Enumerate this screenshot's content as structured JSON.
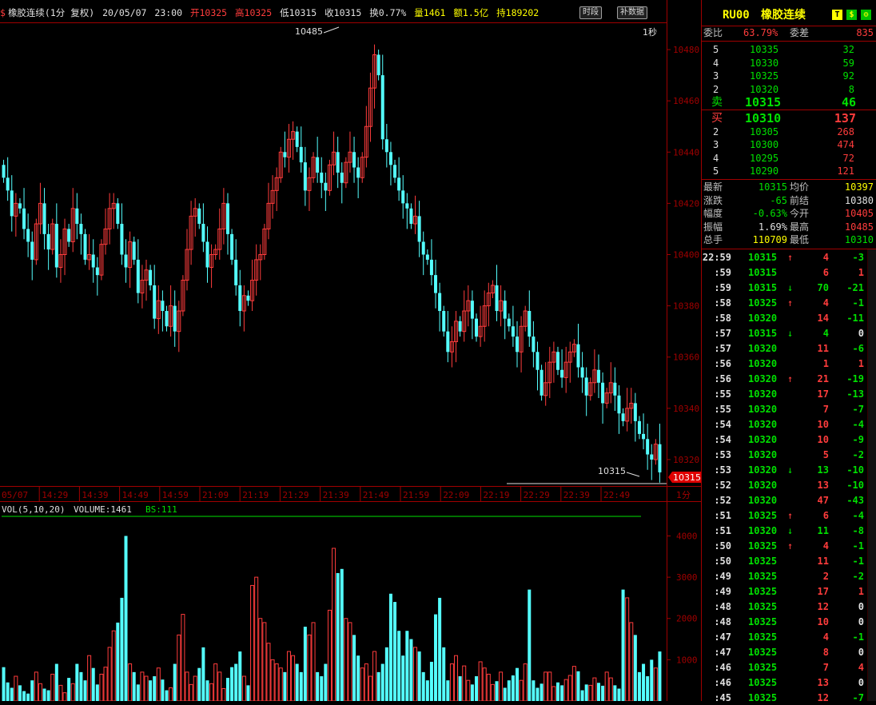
{
  "header": {
    "symbol_icon": "dollar-icon",
    "name": "橡胶连续(1分 复权)",
    "date": "20/05/07",
    "time": "23:00",
    "open": "开10325",
    "high": "高10325",
    "low": "低10315",
    "close": "收10315",
    "turnover": "换0.77%",
    "volume": "量1461",
    "amount": "额1.5亿",
    "position": "持189202",
    "btn_period": "时段",
    "btn_fill": "补数据",
    "second_label": "1秒"
  },
  "panel": {
    "code": "RU00",
    "title": "橡胶连续",
    "btn_t": "T",
    "btn_dollar": "$",
    "wei_bi_label": "委比",
    "wei_bi_value": "63.79%",
    "wei_cha_label": "委差",
    "wei_cha_value": "835",
    "asks": [
      {
        "level": "5",
        "price": "10335",
        "vol": "32"
      },
      {
        "level": "4",
        "price": "10330",
        "vol": "59"
      },
      {
        "level": "3",
        "price": "10325",
        "vol": "92"
      },
      {
        "level": "2",
        "price": "10320",
        "vol": "8"
      },
      {
        "level": "卖",
        "price": "10315",
        "vol": "46"
      }
    ],
    "bids": [
      {
        "level": "买",
        "price": "10310",
        "vol": "137"
      },
      {
        "level": "2",
        "price": "10305",
        "vol": "268"
      },
      {
        "level": "3",
        "price": "10300",
        "vol": "474"
      },
      {
        "level": "4",
        "price": "10295",
        "vol": "72"
      },
      {
        "level": "5",
        "price": "10290",
        "vol": "121"
      }
    ],
    "stats": [
      {
        "l1": "最新",
        "v1": "10315",
        "l2": "均价",
        "v2": "10397"
      },
      {
        "l1": "涨跌",
        "v1": "-65",
        "l2": "前结",
        "v2": "10380"
      },
      {
        "l1": "幅度",
        "v1": "-0.63%",
        "l2": "今开",
        "v2": "10405"
      },
      {
        "l1": "振幅",
        "v1": "1.69%",
        "l2": "最高",
        "v2": "10485"
      },
      {
        "l1": "总手",
        "v1": "110709",
        "l2": "最低",
        "v2": "10310"
      }
    ],
    "ticks": [
      {
        "t": "22:59",
        "p": "10315",
        "a": "↑",
        "v": "4",
        "d": "-3"
      },
      {
        "t": ":59",
        "p": "10315",
        "a": "",
        "v": "6",
        "d": "1"
      },
      {
        "t": ":59",
        "p": "10315",
        "a": "↓",
        "v": "70",
        "d": "-21"
      },
      {
        "t": ":58",
        "p": "10325",
        "a": "↑",
        "v": "4",
        "d": "-1"
      },
      {
        "t": ":58",
        "p": "10320",
        "a": "",
        "v": "14",
        "d": "-11"
      },
      {
        "t": ":57",
        "p": "10315",
        "a": "↓",
        "v": "4",
        "d": "0"
      },
      {
        "t": ":57",
        "p": "10320",
        "a": "",
        "v": "11",
        "d": "-6"
      },
      {
        "t": ":56",
        "p": "10320",
        "a": "",
        "v": "1",
        "d": "1"
      },
      {
        "t": ":56",
        "p": "10320",
        "a": "↑",
        "v": "21",
        "d": "-19"
      },
      {
        "t": ":55",
        "p": "10320",
        "a": "",
        "v": "17",
        "d": "-13"
      },
      {
        "t": ":55",
        "p": "10320",
        "a": "",
        "v": "7",
        "d": "-7"
      },
      {
        "t": ":54",
        "p": "10320",
        "a": "",
        "v": "10",
        "d": "-4"
      },
      {
        "t": ":54",
        "p": "10320",
        "a": "",
        "v": "10",
        "d": "-9"
      },
      {
        "t": ":53",
        "p": "10320",
        "a": "",
        "v": "5",
        "d": "-2"
      },
      {
        "t": ":53",
        "p": "10320",
        "a": "↓",
        "v": "13",
        "d": "-10"
      },
      {
        "t": ":52",
        "p": "10320",
        "a": "",
        "v": "13",
        "d": "-10"
      },
      {
        "t": ":52",
        "p": "10320",
        "a": "",
        "v": "47",
        "d": "-43"
      },
      {
        "t": ":51",
        "p": "10325",
        "a": "↑",
        "v": "6",
        "d": "-4"
      },
      {
        "t": ":51",
        "p": "10320",
        "a": "↓",
        "v": "11",
        "d": "-8"
      },
      {
        "t": ":50",
        "p": "10325",
        "a": "↑",
        "v": "4",
        "d": "-1"
      },
      {
        "t": ":50",
        "p": "10325",
        "a": "",
        "v": "11",
        "d": "-1"
      },
      {
        "t": ":49",
        "p": "10325",
        "a": "",
        "v": "2",
        "d": "-2"
      },
      {
        "t": ":49",
        "p": "10325",
        "a": "",
        "v": "17",
        "d": "1"
      },
      {
        "t": ":48",
        "p": "10325",
        "a": "",
        "v": "12",
        "d": "0"
      },
      {
        "t": ":48",
        "p": "10325",
        "a": "",
        "v": "10",
        "d": "0"
      },
      {
        "t": ":47",
        "p": "10325",
        "a": "",
        "v": "4",
        "d": "-1"
      },
      {
        "t": ":47",
        "p": "10325",
        "a": "",
        "v": "8",
        "d": "0"
      },
      {
        "t": ":46",
        "p": "10325",
        "a": "",
        "v": "7",
        "d": "4"
      },
      {
        "t": ":46",
        "p": "10325",
        "a": "",
        "v": "13",
        "d": "0"
      },
      {
        "t": ":45",
        "p": "10325",
        "a": "",
        "v": "12",
        "d": "-7"
      }
    ]
  },
  "colors": {
    "up": "#ff3c3c",
    "down": "#54ffff",
    "axis": "#a00000",
    "green": "#00e000"
  },
  "chart_data": {
    "type": "candlestick",
    "price_axis": {
      "ticks": [
        "10320",
        "10340",
        "10360",
        "10380",
        "10400",
        "10420",
        "10440",
        "10460",
        "10480"
      ],
      "ylim": [
        10310,
        10490
      ]
    },
    "time_axis": {
      "ticks": [
        "05/07",
        "14:29",
        "14:39",
        "14:49",
        "14:59",
        "21:09",
        "21:19",
        "21:29",
        "21:39",
        "21:49",
        "21:59",
        "22:09",
        "22:19",
        "22:29",
        "22:39",
        "22:49"
      ],
      "unit": "1分"
    },
    "high_label": "10485",
    "low_label": "10315",
    "last_price_label": "10315",
    "volume": {
      "legend": "VOL(5,10,20)",
      "volume_label": "VOLUME:1461",
      "bs_label": "BS:111",
      "ticks": [
        "1000",
        "2000",
        "3000",
        "4000"
      ],
      "ylim": [
        0,
        4300
      ]
    },
    "closes": [
      10430,
      10425,
      10415,
      10420,
      10418,
      10410,
      10405,
      10398,
      10412,
      10420,
      10408,
      10402,
      10412,
      10395,
      10400,
      10410,
      10405,
      10418,
      10412,
      10408,
      10398,
      10400,
      10395,
      10392,
      10404,
      10410,
      10418,
      10420,
      10412,
      10400,
      10395,
      10405,
      10398,
      10385,
      10390,
      10394,
      10388,
      10375,
      10382,
      10378,
      10372,
      10380,
      10370,
      10378,
      10390,
      10402,
      10415,
      10418,
      10412,
      10405,
      10395,
      10400,
      10402,
      10410,
      10420,
      10408,
      10398,
      10388,
      10378,
      10384,
      10382,
      10390,
      10398,
      10400,
      10410,
      10420,
      10425,
      10430,
      10440,
      10438,
      10445,
      10448,
      10442,
      10436,
      10425,
      10430,
      10438,
      10432,
      10428,
      10425,
      10435,
      10440,
      10432,
      10428,
      10436,
      10440,
      10434,
      10430,
      10438,
      10450,
      10465,
      10478,
      10470,
      10445,
      10440,
      10435,
      10430,
      10425,
      10420,
      10418,
      10412,
      10415,
      10405,
      10400,
      10398,
      10392,
      10385,
      10378,
      10370,
      10362,
      10366,
      10374,
      10370,
      10378,
      10382,
      10375,
      10368,
      10372,
      10380,
      10385,
      10388,
      10378,
      10382,
      10375,
      10372,
      10368,
      10362,
      10372,
      10378,
      10368,
      10362,
      10355,
      10345,
      10350,
      10358,
      10362,
      10355,
      10352,
      10358,
      10362,
      10365,
      10356,
      10352,
      10345,
      10350,
      10355,
      10350,
      10342,
      10346,
      10350,
      10345,
      10338,
      10335,
      10340,
      10342,
      10335,
      10330,
      10328,
      10322,
      10320,
      10326,
      10315
    ],
    "volumes": [
      820,
      450,
      320,
      600,
      380,
      240,
      180,
      500,
      700,
      420,
      300,
      260,
      650,
      900,
      380,
      200,
      560,
      420,
      900,
      700,
      500,
      1100,
      800,
      400,
      650,
      820,
      1300,
      1700,
      1900,
      2500,
      4000,
      900,
      700,
      400,
      700,
      600,
      500,
      600,
      800,
      520,
      260,
      320,
      900,
      1600,
      2100,
      700,
      400,
      600,
      800,
      1300,
      500,
      420,
      900,
      700,
      300,
      560,
      820,
      900,
      1200,
      600,
      380,
      2800,
      3000,
      2000,
      1900,
      1400,
      1000,
      900,
      800,
      700,
      1200,
      1100,
      900,
      700,
      1800,
      1600,
      1900,
      700,
      600,
      900,
      2200,
      3700,
      3100,
      3200,
      2000,
      1900,
      1600,
      1100,
      800,
      900,
      600,
      1200,
      700,
      900,
      1300,
      2600,
      2400,
      1700,
      1100,
      1700,
      1500,
      1300,
      1200,
      700,
      500,
      950,
      2100,
      2500,
      1300,
      500,
      900,
      1100,
      600,
      850,
      500,
      400,
      600,
      950,
      800,
      650,
      400,
      480,
      700,
      320,
      500,
      620,
      800,
      500,
      900,
      2700,
      500,
      320,
      420,
      700,
      700,
      350,
      450,
      380,
      520,
      620,
      840,
      720,
      260,
      400,
      380,
      560,
      440,
      370,
      700,
      560,
      380,
      300,
      2700,
      2500,
      1900,
      1600,
      700,
      900,
      600,
      1000,
      800,
      1200,
      1400,
      1000
    ]
  }
}
